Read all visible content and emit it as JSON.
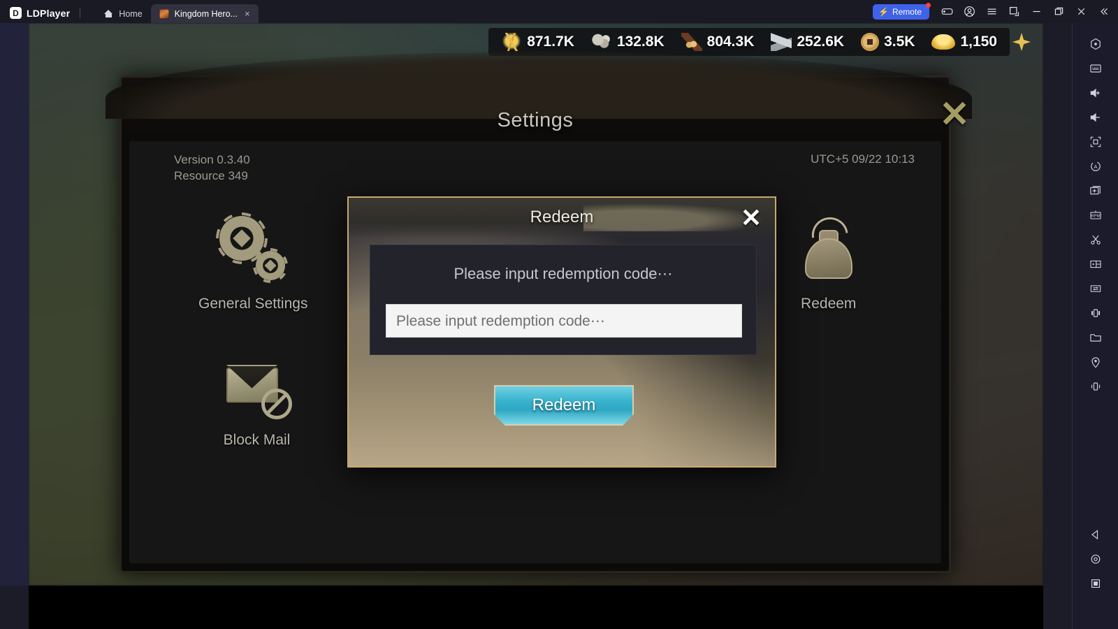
{
  "window": {
    "brand": "LDPlayer",
    "brand_glyph": "ⓟ",
    "tabs": [
      {
        "label": "Home",
        "icon": "home-icon",
        "active": false
      },
      {
        "label": "Kingdom Hero...",
        "icon": "game-thumbnail",
        "active": true,
        "close": "×"
      }
    ],
    "remote_button": {
      "label": "Remote",
      "glyph": "⚡",
      "accent": "#3f62e8",
      "badge": true
    },
    "controls": [
      {
        "name": "gamepad-icon"
      },
      {
        "name": "account-icon"
      },
      {
        "name": "menu-icon"
      },
      {
        "name": "screenshot-icon"
      },
      {
        "name": "minimize-icon"
      },
      {
        "name": "maximize-icon"
      },
      {
        "name": "close-icon"
      },
      {
        "name": "collapse-icon"
      }
    ]
  },
  "game": {
    "resources": [
      {
        "name": "food",
        "icon": "wheat-icon",
        "value": "871.7K"
      },
      {
        "name": "stone",
        "icon": "stone-icon",
        "value": "132.8K"
      },
      {
        "name": "wood",
        "icon": "wood-icon",
        "value": "804.3K"
      },
      {
        "name": "iron",
        "icon": "iron-icon",
        "value": "252.6K"
      },
      {
        "name": "copper-coin",
        "icon": "coin-icon",
        "value": "3.5K"
      },
      {
        "name": "gold-ingot",
        "icon": "ingot-icon",
        "value": "1,150"
      }
    ],
    "gem_icon": "gem-icon"
  },
  "settings": {
    "title": "Settings",
    "close_glyph": "✕",
    "version_line": "Version  0.3.40",
    "resource_line": "Resource 349",
    "server_time": "UTC+5 09/22 10:13",
    "tiles": [
      {
        "label": "General Settings",
        "icon": "gears-icon"
      },
      {
        "label": "Redeem",
        "icon": "bag-icon"
      },
      {
        "label": "Block Mail",
        "icon": "mail-block-icon"
      }
    ]
  },
  "redeem_dialog": {
    "title": "Redeem",
    "close_glyph": "✕",
    "hint": "Please input redemption code⋯",
    "input_value": "",
    "input_placeholder": "Please input redemption code⋯",
    "submit_label": "Redeem",
    "accent": "#39b3cd",
    "border": "#c8a96d"
  },
  "sidebar": {
    "top_items": [
      {
        "name": "power-icon"
      },
      {
        "name": "keyboard-icon"
      },
      {
        "name": "volume-up-icon"
      },
      {
        "name": "volume-down-icon"
      },
      {
        "name": "fullscreen-icon"
      },
      {
        "name": "auto-rotate-icon"
      },
      {
        "name": "add-instance-icon"
      },
      {
        "name": "rpm-icon"
      },
      {
        "name": "scissors-icon"
      },
      {
        "name": "multi-window-icon"
      },
      {
        "name": "sync-icon"
      },
      {
        "name": "shake-icon"
      },
      {
        "name": "folder-icon"
      },
      {
        "name": "location-icon"
      },
      {
        "name": "vibrate-icon"
      }
    ],
    "bottom_items": [
      {
        "name": "back-icon"
      },
      {
        "name": "home-circle-icon"
      },
      {
        "name": "recents-icon"
      }
    ]
  }
}
